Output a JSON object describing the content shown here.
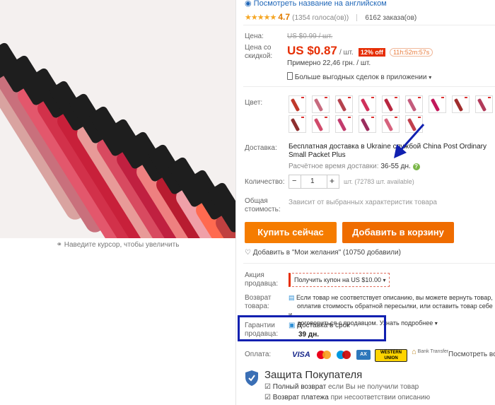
{
  "header": {
    "see_english_link": "Посмотреть название на английском"
  },
  "rating": {
    "stars": 5,
    "value": "4.7",
    "votes": "(1354 голоса(ов))",
    "orders": "6162 заказа(ов)"
  },
  "price": {
    "label": "Цена:",
    "old_price": "US $0.99 / шт.",
    "discount_label_1": "Цена со",
    "discount_label_2": "скидкой:",
    "new_price": "US $0.87",
    "unit": "/ шт.",
    "discount_badge": "12% off",
    "timer": "11h:52m:57s",
    "approx": "Примерно 22,46 грн. / шт.",
    "app_deals": "Больше выгодных сделок в приложении"
  },
  "color": {
    "label": "Цвет:",
    "swatches": [
      "#c0392b",
      "#c76a7e",
      "#b5424e",
      "#d0305a",
      "#b8263f",
      "#c45b7c",
      "#c2185b",
      "#a02c2c",
      "#b23a5a",
      "#8e2f2f",
      "#d04a6a",
      "#c23b6d",
      "#9b2d5e",
      "#d6627d",
      "#c03f4d"
    ]
  },
  "shipping": {
    "label": "Доставка:",
    "text": "Бесплатная доставка в Ukraine службой China Post Ordinary Small Packet Plus",
    "time_label": "Расчётное время доставки:",
    "time_value": "36-55 дн."
  },
  "quantity": {
    "label": "Количество:",
    "value": "1",
    "minus": "−",
    "plus": "+",
    "available": "шт. (72783 шт. available)"
  },
  "total": {
    "label_1": "Общая",
    "label_2": "стоимость:",
    "text": "Зависит от выбранных характеристик товара"
  },
  "actions": {
    "buy_now": "Купить сейчас",
    "add_to_cart": "Добавить в корзину",
    "wishlist": "Добавить в \"Мои желания\" (10750 добавили)"
  },
  "promo": {
    "label_1": "Акция",
    "label_2": "продавца:",
    "coupon": "Получить купон на US $10.00"
  },
  "returns": {
    "label_1": "Возврат",
    "label_2": "товара:",
    "line1": "Если товар не соответствует описанию, вы можете вернуть товар,",
    "line2": "оплатив стоимость обратной пересылки, или оставить товар себе и",
    "line3": "договориться с продавцом. Узнать подробнее"
  },
  "guarantee": {
    "label_1": "Гарантии",
    "label_2": "продавца:",
    "title": "Доставка в срок",
    "days": "39 дн."
  },
  "payment": {
    "label": "Оплата:",
    "methods": [
      "VISA",
      "MasterCard",
      "Maestro",
      "AmEx",
      "WESTERN UNION",
      "Bank Transfer"
    ],
    "more": "Посмотреть все"
  },
  "protection": {
    "title": "Защита Покупателя",
    "item1_bold": "Полный возврат",
    "item1_rest": "если Вы не получили товар",
    "item2_bold": "Возврат платежа",
    "item2_rest": "при несоответствии описанию"
  },
  "photo": {
    "zoom_hint": "Наведите курсор, чтобы увеличить"
  },
  "colors": {
    "primary_orange": "#f57c00",
    "cart_orange": "#ef6c00",
    "price_red": "#e62e04",
    "annotation_blue": "#1020b0"
  }
}
